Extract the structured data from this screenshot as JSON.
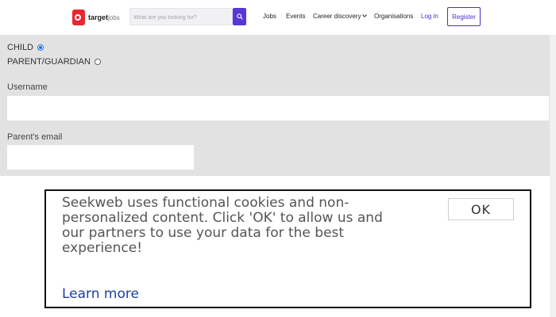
{
  "header": {
    "logo_text": "target",
    "logo_suffix": "jobs",
    "search": {
      "placeholder": "What are you looking for?",
      "value": ""
    },
    "nav": {
      "jobs": "Jobs",
      "events": "Events",
      "career_discovery": "Career discovery",
      "organisations": "Organisations",
      "login": "Log in",
      "register": "Register"
    },
    "icons": {
      "search": "search-icon",
      "dropdown": "chevron-down-icon"
    }
  },
  "form": {
    "role_options": [
      {
        "label": "CHILD",
        "selected": true
      },
      {
        "label": "PARENT/GUARDIAN",
        "selected": false
      }
    ],
    "username": {
      "label": "Username",
      "value": ""
    },
    "parent_email": {
      "label": "Parent's email",
      "value": ""
    }
  },
  "cookie_banner": {
    "message": "Seekweb uses functional cookies and non-personalized content. Click 'OK' to allow us and our partners to use your data for the best experience!",
    "link_text": "Learn more",
    "ok_label": "OK"
  },
  "colors": {
    "brand_red": "#e8262f",
    "accent_purple": "#4b2fc4",
    "search_button": "#5b36d6",
    "radio_selected": "#1a6fe0",
    "form_background": "#e2e2e2",
    "link_blue": "#1d3fa0"
  }
}
